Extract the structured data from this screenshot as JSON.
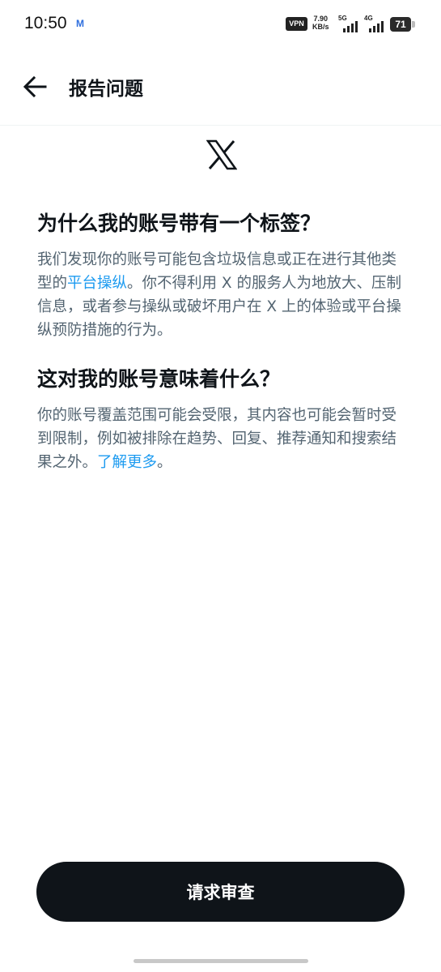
{
  "status_bar": {
    "time": "10:50",
    "notif_icon_label": "M",
    "vpn": "VPN",
    "speed_value": "7.90",
    "speed_unit": "KB/s",
    "signal_1": "5G",
    "signal_2": "4G",
    "battery": "71"
  },
  "header": {
    "title": "报告问题",
    "back_icon": "arrow-left-icon"
  },
  "logo": {
    "icon": "x-logo-icon"
  },
  "section1": {
    "title": "为什么我的账号带有一个标签？",
    "body_1": "我们发现你的账号可能包含垃圾信息或正在进行其他类型的",
    "link": "平台操纵",
    "body_2": "。你不得利用 X 的服务人为地放大、压制信息，或者参与操纵或破坏用户在 X 上的体验或平台操纵预防措施的行为。"
  },
  "section2": {
    "title": "这对我的账号意味着什么？",
    "body_1": "你的账号覆盖范围可能会受限，其内容也可能会暂时受到限制，例如被排除在趋势、回复、推荐通知和搜索结果之外。",
    "link": "了解更多",
    "body_2": "。"
  },
  "footer": {
    "button_label": "请求审查"
  },
  "colors": {
    "text_primary": "#0f1419",
    "text_secondary": "#536471",
    "link": "#1d9bf0",
    "button_bg": "#0f1419"
  }
}
